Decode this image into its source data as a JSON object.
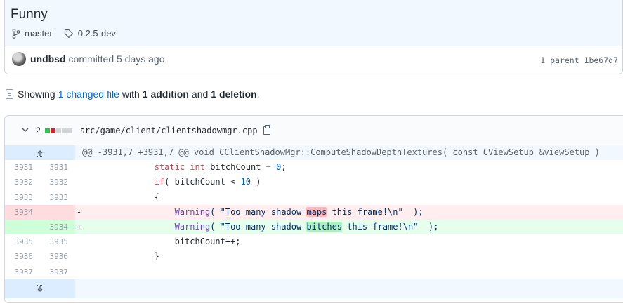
{
  "commit": {
    "title": "Funny",
    "branch": "master",
    "tag": "0.2.5-dev",
    "author": "undbsd",
    "action": "committed 5 days ago",
    "parent": "1 parent 1be67d7"
  },
  "summary": {
    "prefix": "Showing",
    "changed": "1 changed file",
    "with": "with",
    "additions": "1 addition",
    "and": "and",
    "deletions": "1 deletion",
    "period": "."
  },
  "file": {
    "count": "2",
    "path": "src/game/client/clientshadowmgr.cpp",
    "diffstat_colors": [
      "#2cbe4e",
      "#cb2431",
      "#d1d5da",
      "#d1d5da",
      "#d1d5da"
    ]
  },
  "diff": {
    "hunk": "@@ -3931,7 +3931,7 @@ void CClientShadowMgr::ComputeShadowDepthTextures( const CViewSetup &viewSetup )",
    "lines": [
      {
        "old": "3931",
        "new": "3931",
        "sign": "",
        "type": "ctx"
      },
      {
        "old": "3932",
        "new": "3932",
        "sign": "",
        "type": "ctx"
      },
      {
        "old": "3933",
        "new": "3933",
        "sign": "",
        "type": "ctx"
      },
      {
        "old": "3934",
        "new": "",
        "sign": "-",
        "type": "del"
      },
      {
        "old": "",
        "new": "3934",
        "sign": "+",
        "type": "add"
      },
      {
        "old": "3935",
        "new": "3935",
        "sign": "",
        "type": "ctx"
      },
      {
        "old": "3936",
        "new": "3936",
        "sign": "",
        "type": "ctx"
      },
      {
        "old": "3937",
        "new": "3937",
        "sign": "",
        "type": "ctx"
      }
    ],
    "code": {
      "l1_kw1": "static",
      "l1_kw2": "int",
      "l1_rest": " bitchCount = ",
      "l1_num": "0",
      "l1_end": ";",
      "l2_kw": "if",
      "l2_rest": "( bitchCount < ",
      "l2_num": "10",
      "l2_end": " )",
      "l3": "{",
      "l4_fn": "Warning",
      "l4_a": "( \"Too many shadow ",
      "l4_hl": "maps",
      "l4_b": " this frame!\\n\"  );",
      "l5_fn": "Warning",
      "l5_a": "( \"Too many shadow ",
      "l5_hl": "bitches",
      "l5_b": " this frame!\\n\"  );",
      "l6": "bitchCount++;",
      "l7": "}"
    }
  },
  "icons": [
    "branch-icon",
    "tag-icon",
    "file-diff-icon",
    "chevron-down-icon",
    "clipboard-icon",
    "expand-up-icon",
    "expand-down-icon"
  ]
}
